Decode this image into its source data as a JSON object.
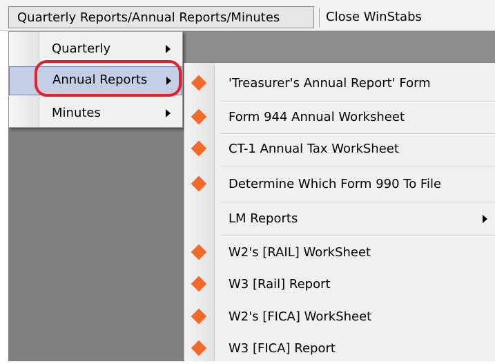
{
  "menubar": {
    "reports_label": "Quarterly Reports/Annual Reports/Minutes",
    "close_label": "Close WinStabs"
  },
  "menu1": {
    "items": [
      {
        "label": "Quarterly"
      },
      {
        "label": "Annual Reports"
      },
      {
        "label": "Minutes"
      }
    ],
    "highlighted": "Annual Reports"
  },
  "menu2": {
    "items": [
      {
        "label": "'Treasurer's Annual Report' Form",
        "icon": "orange-diamond-icon"
      },
      {
        "label": "Form 944 Annual Worksheet",
        "icon": "orange-diamond-icon"
      },
      {
        "label": "CT-1 Annual Tax WorkSheet",
        "icon": "orange-diamond-icon"
      },
      {
        "label": "Determine Which Form 990 To File",
        "icon": "orange-diamond-icon"
      },
      {
        "label": "LM Reports",
        "icon": null
      },
      {
        "label": "W2's [RAIL] WorkSheet",
        "icon": "orange-diamond-icon"
      },
      {
        "label": "W3 [Rail] Report",
        "icon": "orange-diamond-icon"
      },
      {
        "label": "W2's [FICA] WorkSheet",
        "icon": "orange-diamond-icon"
      },
      {
        "label": "W3 [FICA] Report",
        "icon": "orange-diamond-icon"
      }
    ]
  },
  "colors": {
    "icon_orange": "#f26a2a",
    "highlight_red": "#e4202a",
    "selected_bg": "#c4cfe6",
    "app_background": "#7f7f7f"
  }
}
